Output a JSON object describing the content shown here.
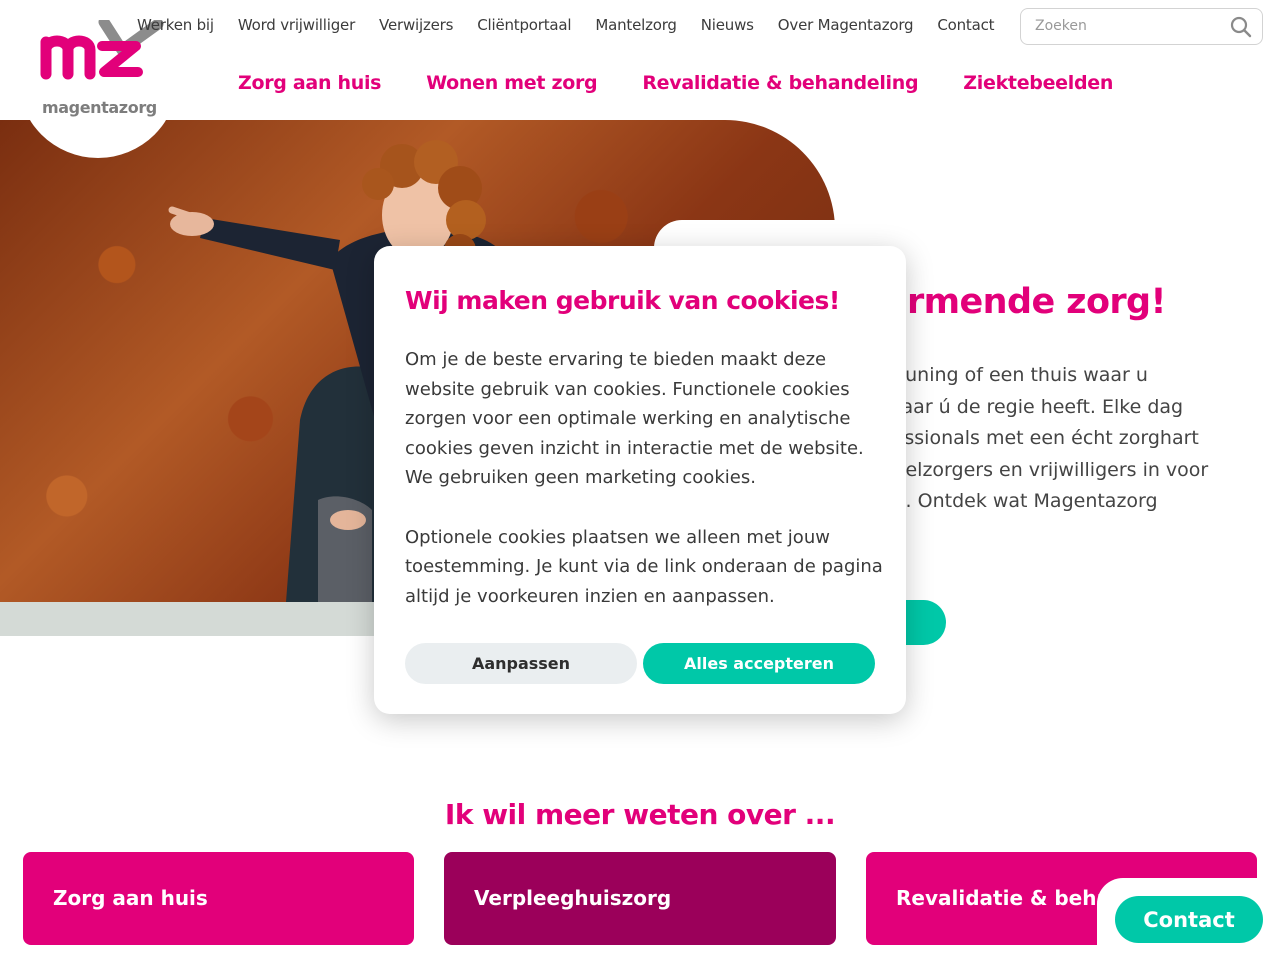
{
  "brand": {
    "logo_text": "magentazorg",
    "primary_color": "#e2007a",
    "accent_color": "#00c8a8",
    "dark_magenta": "#9b005a"
  },
  "topnav": [
    {
      "label": "Werken bij"
    },
    {
      "label": "Word vrijwilliger"
    },
    {
      "label": "Verwijzers"
    },
    {
      "label": "Cliëntportaal"
    },
    {
      "label": "Mantelzorg"
    },
    {
      "label": "Nieuws"
    },
    {
      "label": "Over Magentazorg"
    },
    {
      "label": "Contact"
    }
  ],
  "search": {
    "placeholder": "Zoeken",
    "icon": "search-icon"
  },
  "mainnav": [
    {
      "label": "Zorg aan huis"
    },
    {
      "label": "Wonen met zorg"
    },
    {
      "label": "Revalidatie & behandeling"
    },
    {
      "label": "Ziektebeelden"
    }
  ],
  "hero": {
    "title_visible": "armende zorg!",
    "text_lines": [
      "teuning of een thuis waar u",
      "waar ú de regie heeft. Elke dag",
      "fessionals met een écht zorghart",
      "ntelzorgers en vrijwilligers in voor",
      "rg. Ontdek wat Magentazorg"
    ]
  },
  "cookie_modal": {
    "title": "Wij maken gebruik van cookies!",
    "paragraph1_lines": [
      "Om je de beste ervaring te bieden maakt deze",
      "website gebruik van cookies. Functionele cookies",
      "zorgen voor een optimale werking en analytische",
      "cookies geven inzicht in interactie met de website.",
      "We gebruiken geen marketing cookies."
    ],
    "paragraph2_lines": [
      "Optionele cookies plaatsen we alleen met jouw",
      "toestemming. Je kunt via de link onderaan de pagina",
      "altijd je voorkeuren inzien en aanpassen."
    ],
    "customize_label": "Aanpassen",
    "accept_label": "Alles accepteren"
  },
  "more_info": {
    "title": "Ik wil meer weten over ...",
    "tiles": [
      {
        "label": "Zorg aan huis"
      },
      {
        "label": "Verpleeghuiszorg"
      },
      {
        "label": "Revalidatie & behandeling"
      }
    ]
  },
  "contact_button": {
    "label": "Contact"
  }
}
